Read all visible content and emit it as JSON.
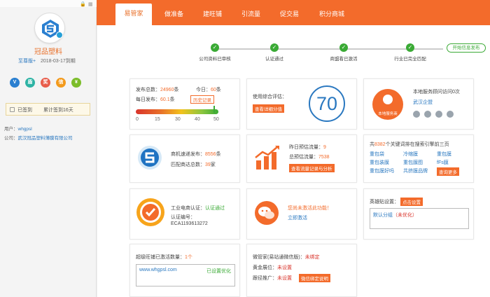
{
  "sidebar": {
    "company": "冠品塑料",
    "vip_label": "至尊版+",
    "expire": "2018-03-17到期",
    "badges": [
      "V",
      "盾",
      "奖",
      "信",
      "¥"
    ],
    "signed_label": "已签到",
    "signed_days": "累计签到16天",
    "user_label": "用户：",
    "user_value": "whgpsl",
    "company_label": "公司：",
    "company_value": "武汉冠品塑料薄膜有限公司"
  },
  "nav": {
    "tabs": [
      "易管家",
      "做准备",
      "建旺铺",
      "引流量",
      "促交易",
      "积分商城"
    ]
  },
  "steps": {
    "items": [
      "公司资料已审核",
      "认证通过",
      "商盟看已激活",
      "行业已完全匹配"
    ],
    "final": "开始信息发布"
  },
  "card1": {
    "total_label": "发布总数：",
    "total_value": "24960",
    "total_unit": "条",
    "today_label": "今日：",
    "today_value": "60",
    "today_unit": "条",
    "daily_label": "每日发布：",
    "daily_value": "60.1",
    "daily_unit": "条",
    "history_btn": "历史记录",
    "ticks": [
      "0",
      "15",
      "30",
      "40",
      "50"
    ]
  },
  "card2": {
    "label": "使用综合评估：",
    "btn": "查看详细分值",
    "score": "70"
  },
  "card3": {
    "title": "本地服务顾问访问0次",
    "avatar_text": "本地服务商",
    "city": "武汉企盟"
  },
  "card4": {
    "line1_label": "商机速递发布：",
    "line1_value": "8556",
    "line1_unit": "条",
    "line2_label": "匹配商达总数：",
    "line2_value": "39",
    "line2_unit": "家"
  },
  "card5": {
    "line1_label": "昨日预估流量：",
    "line1_value": "9",
    "line2_label": "总预估流量：",
    "line2_value": "7538",
    "btn": "查看流量记录与分析"
  },
  "card6": {
    "title_pre": "共",
    "title_num": "8382",
    "title_post": "个关键词排在搜索引擎前三页",
    "keywords": [
      "重包袋",
      "冷缩膜",
      "重包膜",
      "重包装膜",
      "重包膜图",
      "fFs膜",
      "重包膜好吗",
      "共挤膜品牌"
    ],
    "more_btn": "查询更多"
  },
  "card7": {
    "line1_label": "工业电商认证：",
    "line1_value": "认证通过",
    "line2_label": "认证编号：",
    "line2_value": "ECA1193613272"
  },
  "card8": {
    "line1": "您尚未激活此功能！",
    "line2": "立即激活"
  },
  "card9": {
    "label": "英雄贴设置：",
    "btn": "点击设置",
    "row_label": "默认分组",
    "row_status": "（未优化）"
  },
  "card10": {
    "label": "超级旺铺已激活数量：",
    "count": "1个",
    "url": "www.whgpsl.com",
    "status": "已设置优化"
  },
  "card11": {
    "line1_label": "微管家(易站通微信版)：",
    "line1_value": "未绑定",
    "line2_label": "黄金展位：",
    "line2_value": "未设置",
    "line3_label": "跟径推广：",
    "line3_value": "未设置",
    "line3_btn": "微信绑定说明"
  },
  "colors": {
    "accent": "#f36b2b",
    "link": "#2a78c0",
    "success": "#3aaa35"
  }
}
